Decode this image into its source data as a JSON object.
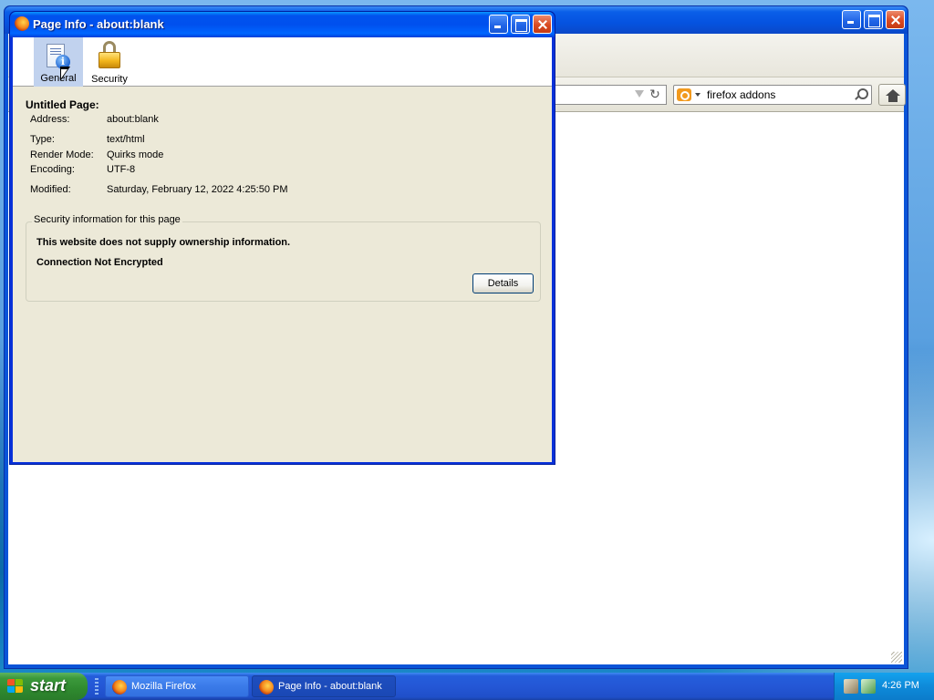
{
  "browser": {
    "title": "",
    "search_value": "firefox addons"
  },
  "dialog": {
    "title": "Page Info - about:blank",
    "panes": [
      {
        "label": "General",
        "selected": true,
        "icon": "page-info-icon"
      },
      {
        "label": "Security",
        "selected": false,
        "icon": "padlock-icon"
      }
    ],
    "page_title": "Untitled Page:",
    "fields": {
      "address": {
        "label": "Address:",
        "value": "about:blank"
      },
      "type": {
        "label": "Type:",
        "value": "text/html"
      },
      "render_mode": {
        "label": "Render Mode:",
        "value": "Quirks mode"
      },
      "encoding": {
        "label": "Encoding:",
        "value": "UTF-8"
      },
      "modified": {
        "label": "Modified:",
        "value": "Saturday, February 12, 2022 4:25:50 PM"
      }
    },
    "security": {
      "legend": "Security information for this page",
      "ownership": "This website does not supply ownership information.",
      "connection": "Connection Not Encrypted",
      "details_label": "Details"
    }
  },
  "taskbar": {
    "start_label": "start",
    "tasks": [
      {
        "label": "Mozilla Firefox",
        "active": false
      },
      {
        "label": "Page Info - about:blank",
        "active": true
      }
    ],
    "clock": "4:26 PM"
  },
  "colors": {
    "xp_title_blue": "#0053ee",
    "dialog_face": "#ece9d8",
    "start_green": "#3c9a3c",
    "taskbar_blue": "#245edb"
  }
}
